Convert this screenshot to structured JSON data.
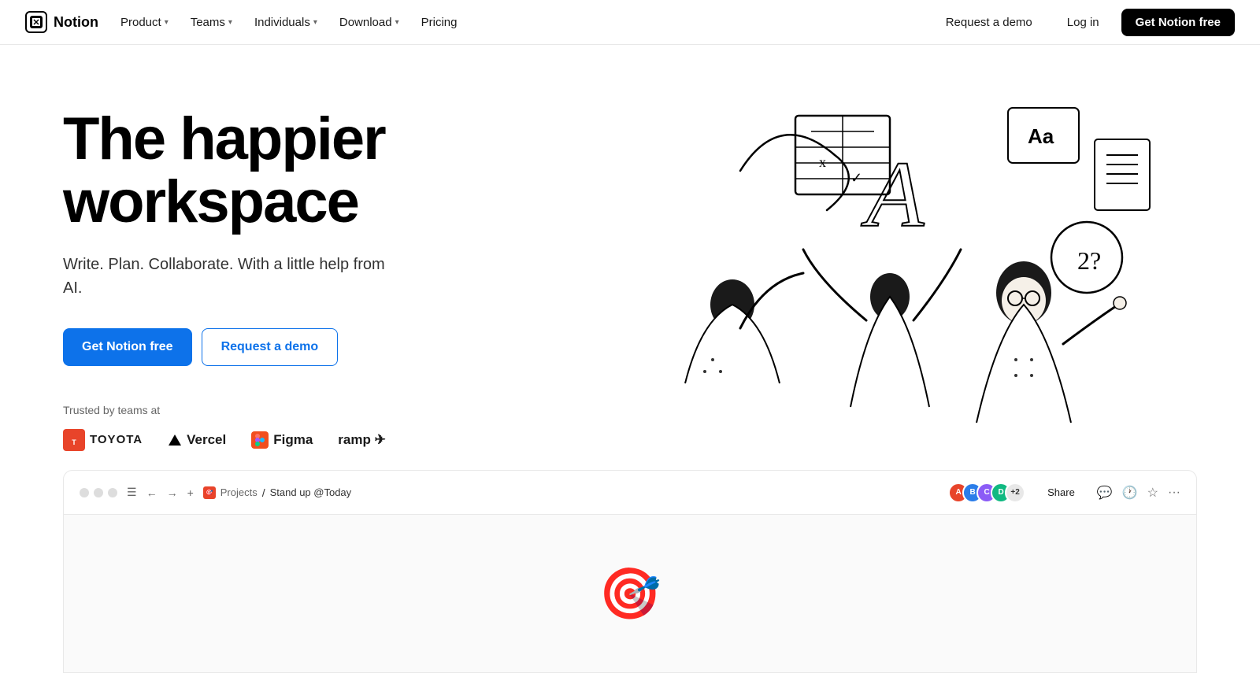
{
  "brand": {
    "name": "Notion",
    "logo_char": "N"
  },
  "nav": {
    "links": [
      {
        "label": "Product",
        "has_dropdown": true
      },
      {
        "label": "Teams",
        "has_dropdown": true
      },
      {
        "label": "Individuals",
        "has_dropdown": true
      },
      {
        "label": "Download",
        "has_dropdown": true
      },
      {
        "label": "Pricing",
        "has_dropdown": false
      }
    ],
    "right": {
      "request_demo": "Request a demo",
      "login": "Log in",
      "get_notion": "Get Notion free"
    }
  },
  "hero": {
    "title_line1": "The happier",
    "title_line2": "workspace",
    "subtitle": "Write. Plan. Collaborate. With a little help from AI.",
    "cta_primary": "Get Notion free",
    "cta_secondary": "Request a demo",
    "trusted_label": "Trusted by teams at",
    "logos": [
      {
        "name": "Toyota",
        "type": "toyota"
      },
      {
        "name": "Vercel",
        "type": "vercel"
      },
      {
        "name": "Figma",
        "type": "figma"
      },
      {
        "name": "ramp ✈",
        "type": "ramp"
      }
    ]
  },
  "app_preview": {
    "breadcrumb_icon_label": "🎯",
    "breadcrumb_parent": "Projects",
    "breadcrumb_separator": "/",
    "breadcrumb_child": "Stand up @Today",
    "avatar_count_label": "+2",
    "share_label": "Share",
    "icons": [
      "💬",
      "🕐",
      "☆",
      "···"
    ]
  },
  "colors": {
    "primary_blue": "#0d72ea",
    "notion_black": "#000000",
    "avatar1": "#e8442a",
    "avatar2": "#2b7de9",
    "avatar3": "#8b5cf6",
    "avatar4": "#10b981"
  }
}
